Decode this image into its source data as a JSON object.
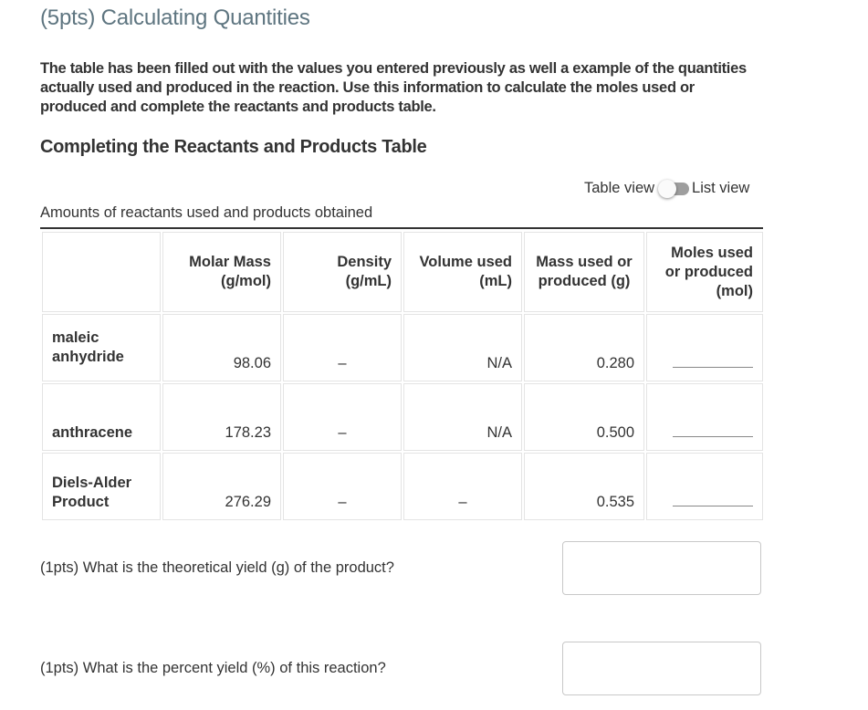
{
  "title": "(5pts) Calculating Quantities",
  "intro": "The table has been filled out with the values you entered previously as well a example of the quantities actually used and produced in the reaction. Use this information to calculate the moles used or produced and complete the reactants and products table.",
  "subheading": "Completing the Reactants and Products Table",
  "view_toggle": {
    "left_label": "Table view",
    "right_label": "List view",
    "state": "Table view"
  },
  "table": {
    "caption": "Amounts of reactants used and products obtained",
    "headers": [
      "",
      "Molar Mass (g/mol)",
      "Density (g/mL)",
      "Volume used (mL)",
      "Mass used or produced (g)",
      "Moles used or produced (mol)"
    ],
    "header_lines": [
      [
        ""
      ],
      [
        "Molar Mass",
        "(g/mol)"
      ],
      [
        "Density",
        "(g/mL)"
      ],
      [
        "Volume used",
        "(mL)"
      ],
      [
        "Mass used or",
        "produced (g)"
      ],
      [
        "Moles used",
        "or produced",
        "(mol)"
      ]
    ],
    "rows": [
      {
        "name_lines": [
          "maleic",
          "anhydride"
        ],
        "molar_mass": "98.06",
        "density": "–",
        "volume": "N/A",
        "mass": "0.280",
        "moles": ""
      },
      {
        "name_lines": [
          "anthracene"
        ],
        "molar_mass": "178.23",
        "density": "–",
        "volume": "N/A",
        "mass": "0.500",
        "moles": ""
      },
      {
        "name_lines": [
          "Diels-Alder",
          "Product"
        ],
        "molar_mass": "276.29",
        "density": "–",
        "volume": "–",
        "mass": "0.535",
        "moles": ""
      }
    ]
  },
  "questions": [
    {
      "label": "(1pts)  What is the theoretical yield (g) of the product?",
      "value": ""
    },
    {
      "label": "(1pts)  What is the percent yield (%) of this reaction?",
      "value": ""
    }
  ]
}
